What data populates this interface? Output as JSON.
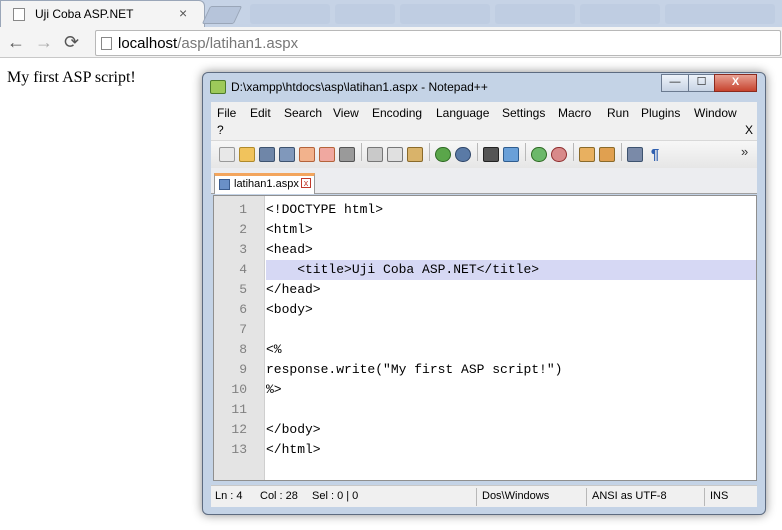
{
  "browser": {
    "tab_title": "Uji Coba ASP.NET",
    "tab_close": "×",
    "back": "←",
    "forward": "→",
    "reload": "⟳",
    "url_host": "localhost",
    "url_path": "/asp/latihan1.aspx"
  },
  "page": {
    "text": "My first ASP script!"
  },
  "npp": {
    "title": "D:\\xampp\\htdocs\\asp\\latihan1.aspx - Notepad++",
    "min": "—",
    "max": "☐",
    "close": "X",
    "menu": [
      "File",
      "Edit",
      "Search",
      "View",
      "Encoding",
      "Language",
      "Settings",
      "Macro",
      "Run",
      "Plugins",
      "Window",
      "?"
    ],
    "menu_close": "X",
    "toolbar_overflow": "»",
    "doc_tab": "latihan1.aspx",
    "doc_tab_close": "x",
    "lines": [
      {
        "n": "1",
        "code": "<!DOCTYPE html>"
      },
      {
        "n": "2",
        "code": "<html>"
      },
      {
        "n": "3",
        "code": "<head>"
      },
      {
        "n": "4",
        "code": "    <title>Uji Coba ASP.NET</title>"
      },
      {
        "n": "5",
        "code": "</head>"
      },
      {
        "n": "6",
        "code": "<body>"
      },
      {
        "n": "7",
        "code": ""
      },
      {
        "n": "8",
        "code": "<%"
      },
      {
        "n": "9",
        "code": "response.write(\"My first ASP script!\")"
      },
      {
        "n": "10",
        "code": "%>"
      },
      {
        "n": "11",
        "code": ""
      },
      {
        "n": "12",
        "code": "</body>"
      },
      {
        "n": "13",
        "code": "</html>"
      }
    ],
    "status": {
      "ln": "Ln : 4",
      "col": "Col : 28",
      "sel": "Sel : 0 | 0",
      "eol": "Dos\\Windows",
      "encoding": "ANSI as UTF-8",
      "mode": "INS"
    }
  }
}
